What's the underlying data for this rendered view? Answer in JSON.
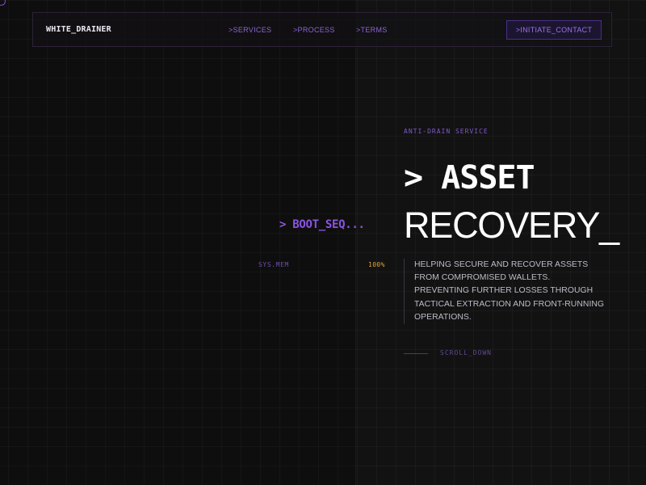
{
  "nav": {
    "brand": "WHITE_DRAINER",
    "links": [
      {
        "label": ">SERVICES"
      },
      {
        "label": ">PROCESS"
      },
      {
        "label": ">TERMS"
      }
    ],
    "cta_label": ">INITIATE_CONTACT"
  },
  "boot": {
    "label": "> BOOT_SEQ...",
    "sys_label": "SYS.MEM",
    "sys_value": "100%"
  },
  "hero": {
    "eyebrow": "ANTI-DRAIN SERVICE",
    "title_line1": "> ASSET",
    "title_line2": "RECOVERY_",
    "description": "HELPING SECURE AND RECOVER ASSETS FROM COMPROMISED WALLETS. PREVENTING FURTHER LOSSES THROUGH TACTICAL EXTRACTION AND FRONT-RUNNING OPERATIONS.",
    "scroll_label": "SCROLL_DOWN"
  },
  "colors": {
    "background": "#131213",
    "accent": "#8a55e0",
    "status": "#e0a23a"
  }
}
